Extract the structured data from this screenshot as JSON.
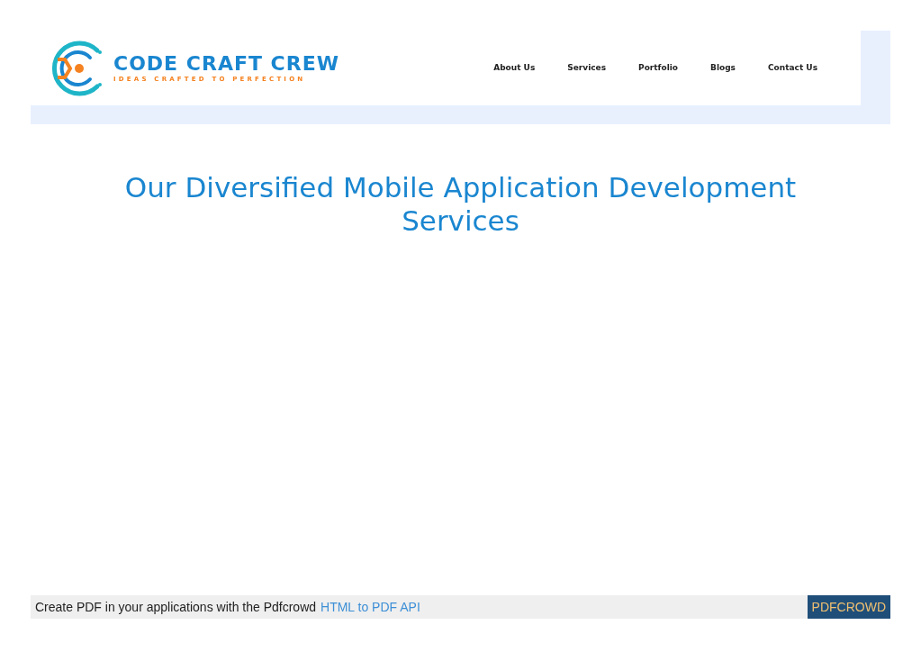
{
  "logo": {
    "name": "CODE CRAFT CREW",
    "tagline": "IDEAS CRAFTED TO PERFECTION"
  },
  "nav": [
    {
      "label": "About Us"
    },
    {
      "label": "Services"
    },
    {
      "label": "Portfolio"
    },
    {
      "label": "Blogs"
    },
    {
      "label": "Contact Us"
    }
  ],
  "heading": "Our Diversified Mobile Application Development Services",
  "footer": {
    "text": "Create PDF in your applications with the Pdfcrowd",
    "link": "HTML to PDF API",
    "badge": "PDFCROWD"
  }
}
